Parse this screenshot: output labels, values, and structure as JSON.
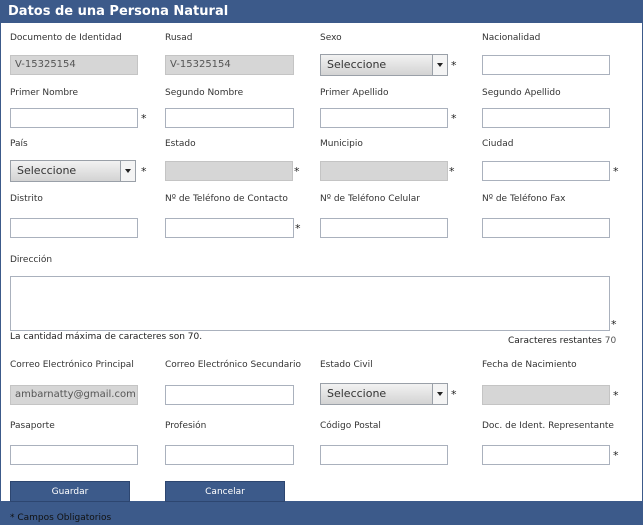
{
  "title": "Datos de una Persona Natural",
  "required_mark": "*",
  "fields": {
    "documento": {
      "label": "Documento de Identidad",
      "value": "V-15325154"
    },
    "rusad": {
      "label": "Rusad",
      "value": "V-15325154"
    },
    "sexo": {
      "label": "Sexo",
      "value": "Seleccione"
    },
    "nacionalidad": {
      "label": "Nacionalidad",
      "value": ""
    },
    "primer_nombre": {
      "label": "Primer Nombre",
      "value": ""
    },
    "segundo_nombre": {
      "label": "Segundo Nombre",
      "value": ""
    },
    "primer_apellido": {
      "label": "Primer Apellido",
      "value": ""
    },
    "segundo_apellido": {
      "label": "Segundo Apellido",
      "value": ""
    },
    "pais": {
      "label": "País",
      "value": "Seleccione"
    },
    "estado": {
      "label": "Estado",
      "value": ""
    },
    "municipio": {
      "label": "Municipio",
      "value": ""
    },
    "ciudad": {
      "label": "Ciudad",
      "value": ""
    },
    "distrito": {
      "label": "Distrito",
      "value": ""
    },
    "tel_contacto": {
      "label": "Nº de Teléfono de Contacto",
      "value": ""
    },
    "tel_celular": {
      "label": "Nº de Teléfono Celular",
      "value": ""
    },
    "tel_fax": {
      "label": "Nº de Teléfono Fax",
      "value": ""
    },
    "direccion": {
      "label": "Dirección",
      "value": ""
    },
    "correo_principal": {
      "label": "Correo Electrónico Principal",
      "value": "ambarnatty@gmail.com"
    },
    "correo_secundario": {
      "label": "Correo Electrónico Secundario",
      "value": ""
    },
    "estado_civil": {
      "label": "Estado Civil",
      "value": "Seleccione"
    },
    "fecha_nacimiento": {
      "label": "Fecha de Nacimiento",
      "value": ""
    },
    "pasaporte": {
      "label": "Pasaporte",
      "value": ""
    },
    "profesion": {
      "label": "Profesión",
      "value": ""
    },
    "codigo_postal": {
      "label": "Código Postal",
      "value": ""
    },
    "doc_representante": {
      "label": "Doc. de Ident. Representante",
      "value": ""
    }
  },
  "direccion_max_note": "La cantidad máxima de caracteres son 70.",
  "caracteres_restantes_label": "Caracteres restantes",
  "caracteres_restantes_value": "70",
  "buttons": {
    "guardar": "Guardar",
    "cancelar": "Cancelar"
  },
  "footer_note": "* Campos Obligatorios",
  "colors": {
    "header": "#3c5a8a",
    "disabled": "#d6d6d6"
  }
}
